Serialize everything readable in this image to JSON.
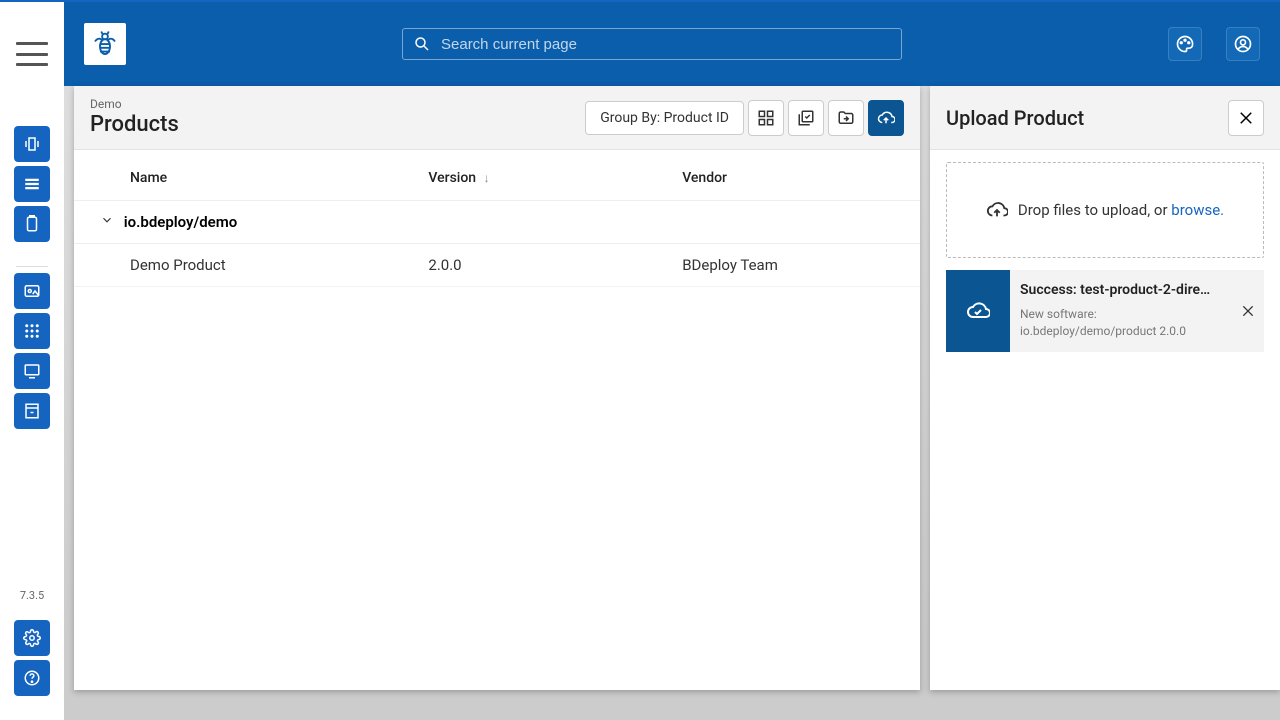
{
  "colors": {
    "brand": "#0b5eac",
    "accent": "#1565c0",
    "railBtn": "#1565c0"
  },
  "rail": {
    "version": "7.3.5"
  },
  "search": {
    "placeholder": "Search current page"
  },
  "breadcrumb": "Demo",
  "page_title": "Products",
  "toolbar": {
    "group_by_label": "Group By: Product ID"
  },
  "table": {
    "columns": {
      "name": "Name",
      "version": "Version",
      "vendor": "Vendor"
    },
    "group": {
      "id": "io.bdeploy/demo"
    },
    "rows": [
      {
        "name": "Demo Product",
        "version": "2.0.0",
        "vendor": "BDeploy Team"
      }
    ]
  },
  "upload_panel": {
    "title": "Upload Product",
    "drop_text": "Drop files to upload, or ",
    "browse_label": "browse.",
    "item": {
      "title": "Success: test-product-2-dire…",
      "subtitle": "New software: io.bdeploy/demo/product 2.0.0"
    }
  }
}
